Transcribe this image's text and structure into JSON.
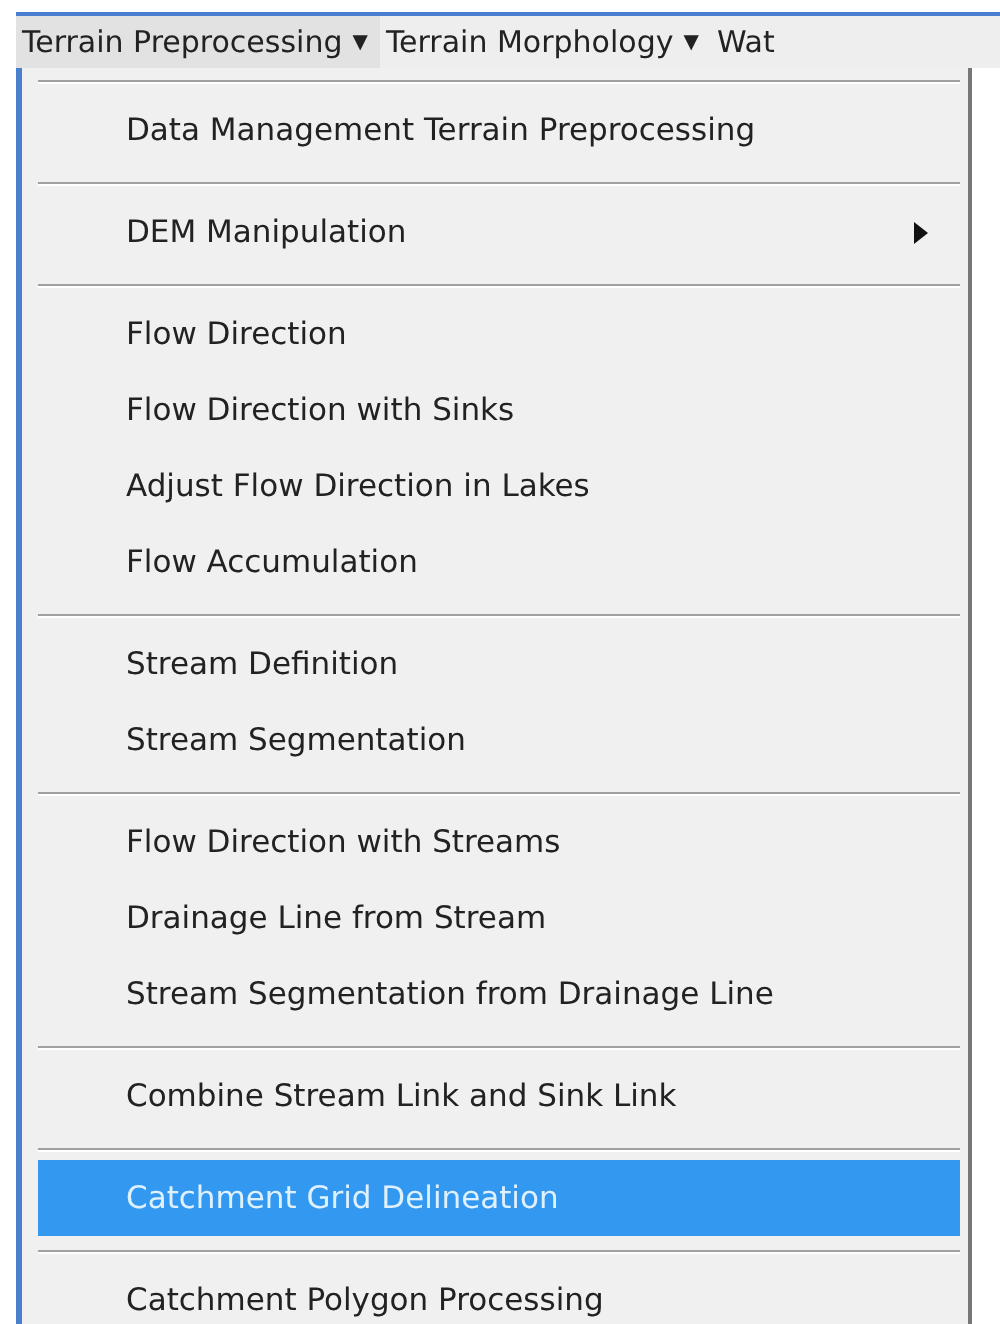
{
  "menu_bar": [
    {
      "label": "Terrain Preprocessing",
      "selected": true,
      "arrow": "▼"
    },
    {
      "label": "Terrain Morphology",
      "selected": false,
      "arrow": "▼"
    },
    {
      "label": "Wat",
      "selected": false
    }
  ],
  "menu": {
    "groups": [
      [
        {
          "label": "Data Management Terrain Preprocessing",
          "selected": false,
          "has_submenu": false
        }
      ],
      [
        {
          "label": "DEM Manipulation",
          "selected": false,
          "has_submenu": true
        }
      ],
      [
        {
          "label": "Flow Direction",
          "selected": false,
          "has_submenu": false
        },
        {
          "label": "Flow Direction with Sinks",
          "selected": false,
          "has_submenu": false
        },
        {
          "label": "Adjust Flow Direction in Lakes",
          "selected": false,
          "has_submenu": false
        },
        {
          "label": "Flow Accumulation",
          "selected": false,
          "has_submenu": false
        }
      ],
      [
        {
          "label": "Stream Definition",
          "selected": false,
          "has_submenu": false
        },
        {
          "label": "Stream Segmentation",
          "selected": false,
          "has_submenu": false
        }
      ],
      [
        {
          "label": "Flow Direction with Streams",
          "selected": false,
          "has_submenu": false
        },
        {
          "label": "Drainage Line from Stream",
          "selected": false,
          "has_submenu": false
        },
        {
          "label": "Stream Segmentation from Drainage Line",
          "selected": false,
          "has_submenu": false
        }
      ],
      [
        {
          "label": "Combine Stream Link and Sink Link",
          "selected": false,
          "has_submenu": false
        }
      ],
      [
        {
          "label": "Catchment Grid Delineation",
          "selected": true,
          "has_submenu": false
        }
      ],
      [
        {
          "label": "Catchment Polygon Processing",
          "selected": false,
          "has_submenu": false
        }
      ]
    ]
  }
}
